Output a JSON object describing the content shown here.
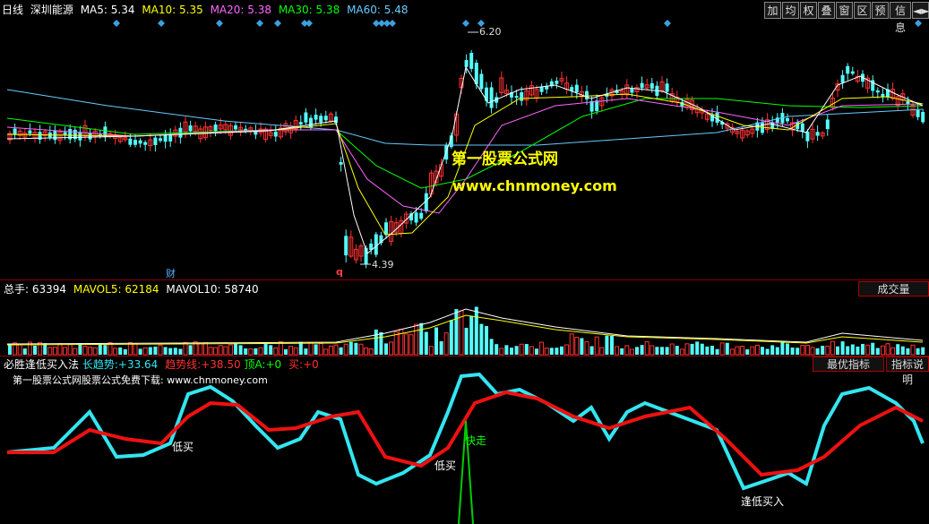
{
  "header": {
    "period": "日线",
    "stock_name": "深圳能源",
    "ma5": {
      "label": "MA5:",
      "value": "5.34",
      "color": "#ffffff"
    },
    "ma10": {
      "label": "MA10:",
      "value": "5.35",
      "color": "#ffff00"
    },
    "ma20": {
      "label": "MA20:",
      "value": "5.38",
      "color": "#ff66ff"
    },
    "ma30": {
      "label": "MA30:",
      "value": "5.38",
      "color": "#00ff00"
    },
    "ma60": {
      "label": "MA60:",
      "value": "5.48",
      "color": "#66ccff"
    }
  },
  "toolbar": [
    "加",
    "均",
    "权",
    "叠",
    "窗",
    "区",
    "预",
    "信息",
    "◄►"
  ],
  "price_panel": {
    "high_label": "6.20",
    "low_label": "4.39",
    "finance_marker": "财",
    "q_marker": "q",
    "watermark_cn": "第一股票公式网",
    "watermark_url": "www.chnmoney.com"
  },
  "volume_panel": {
    "total_label": "总手:",
    "total_value": "63394",
    "mavol5_label": "MAVOL5:",
    "mavol5_value": "62184",
    "mavol10_label": "MAVOL10:",
    "mavol10_value": "58740",
    "button": "成交量"
  },
  "indicator_panel": {
    "name": "必胜逢低买入法",
    "long_trend_label": "长趋势:",
    "long_trend_value": "+33.64",
    "trend_label": "趋势线:",
    "trend_value": "+38.50",
    "top_label": "顶A:",
    "top_value": "+0",
    "buy_label": "买:",
    "buy_value": "+0",
    "subtitle": "第一股票公式网股票公式免费下载: www.chnmoney.com",
    "btn_best": "最优指标",
    "btn_help": "指标说明",
    "annotations": [
      "低买",
      "低买",
      "快走",
      "逢低买入"
    ]
  },
  "colors": {
    "up": "#ff3232",
    "down": "#54fcfc",
    "long_trend": "#33e5f0",
    "trend": "#ee1111",
    "signal": "#00cc00"
  }
}
